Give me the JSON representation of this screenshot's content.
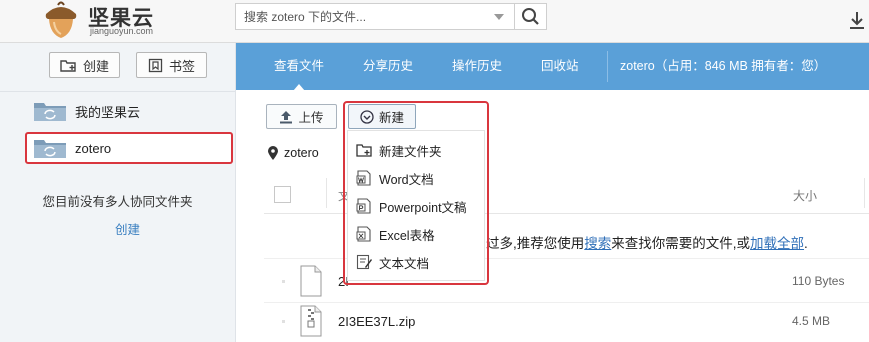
{
  "header": {
    "brand": "坚果云",
    "brand_sub": "jianguoyun.com",
    "search_placeholder": "搜索 zotero 下的文件..."
  },
  "sidebar": {
    "create_label": "创建",
    "bookmark_label": "书签",
    "folders": [
      {
        "label": "我的坚果云",
        "selected": false
      },
      {
        "label": "zotero",
        "selected": true
      }
    ],
    "empty_text": "您目前没有多人协同文件夹",
    "create_link": "创建"
  },
  "nav": {
    "tabs": [
      "查看文件",
      "分享历史",
      "操作历史",
      "回收站"
    ],
    "active_tab": "查看文件",
    "info": "zotero（占用：846 MB   拥有者：您）"
  },
  "toolbar": {
    "upload_label": "上传",
    "new_label": "新建"
  },
  "breadcrumb": {
    "label": "zotero"
  },
  "table": {
    "col_name": "文",
    "col_size": "大小",
    "notice_pre": "过多,推荐您使用",
    "notice_link1": "搜索",
    "notice_mid": "来查找你需要的文件,或",
    "notice_link2": "加载全部",
    "notice_post": ".",
    "rows": [
      {
        "name": "2I",
        "size": "110 Bytes"
      },
      {
        "name": "2I3EE37L.zip",
        "size": "4.5 MB"
      }
    ]
  },
  "new_menu": {
    "items": [
      {
        "label": "新建文件夹",
        "icon": "new-folder-icon"
      },
      {
        "label": "Word文档",
        "icon": "word-doc-icon"
      },
      {
        "label": "Powerpoint文稿",
        "icon": "powerpoint-doc-icon"
      },
      {
        "label": "Excel表格",
        "icon": "excel-doc-icon"
      },
      {
        "label": "文本文档",
        "icon": "text-doc-icon"
      }
    ]
  },
  "colors": {
    "nav_bg": "#5aa0d8",
    "highlight": "#d9363e",
    "link": "#2f6fb8"
  }
}
